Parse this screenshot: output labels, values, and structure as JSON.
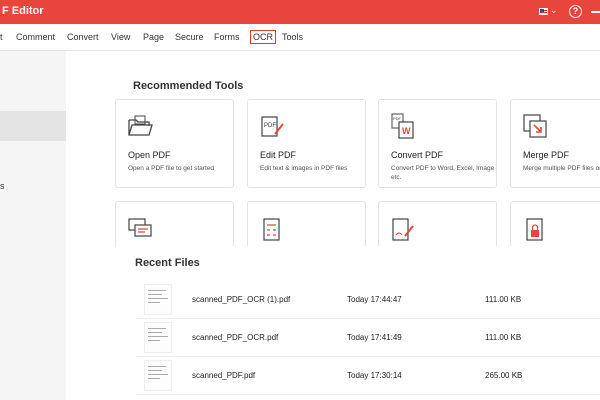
{
  "titlebar": {
    "title": "F Editor",
    "flag": "us-flag-icon",
    "help_glyph": "?"
  },
  "menu": [
    "t",
    "Comment",
    "Convert",
    "View",
    "Page",
    "Secure",
    "Forms",
    "OCR",
    "Tools"
  ],
  "sidebar_text": [
    "s"
  ],
  "recommended": {
    "title": "Recommended Tools",
    "tools": [
      {
        "name": "Open PDF",
        "desc": "Open a PDF file to get started",
        "icon": "folder-open-icon"
      },
      {
        "name": "Edit PDF",
        "desc": "Edit text & images in PDF files",
        "icon": "pdf-edit-icon"
      },
      {
        "name": "Convert PDF",
        "desc": "Convert PDF to Word, Excel, Image etc.",
        "icon": "pdf-to-word-icon"
      },
      {
        "name": "Merge PDF",
        "desc": "Merge multiple PDF files one",
        "icon": "merge-arrows-icon"
      }
    ],
    "tools_row2": [
      {
        "icon": "comment-bubbles-icon"
      },
      {
        "icon": "calculator-pages-icon"
      },
      {
        "icon": "sign-pen-icon"
      },
      {
        "icon": "pdf-lock-icon"
      }
    ]
  },
  "recent": {
    "title": "Recent Files",
    "files": [
      {
        "name": "scanned_PDF_OCR (1).pdf",
        "time": "Today 17:44:47",
        "size": "111.00 KB"
      },
      {
        "name": "scanned_PDF_OCR.pdf",
        "time": "Today 17:41:49",
        "size": "111.00 KB"
      },
      {
        "name": "scanned_PDF.pdf",
        "time": "Today 17:30:14",
        "size": "265.00 KB"
      }
    ]
  },
  "colors": {
    "accent": "#e8453c",
    "menu_highlight": "#e03c31",
    "sidebar_bg": "#f5f5f5"
  }
}
